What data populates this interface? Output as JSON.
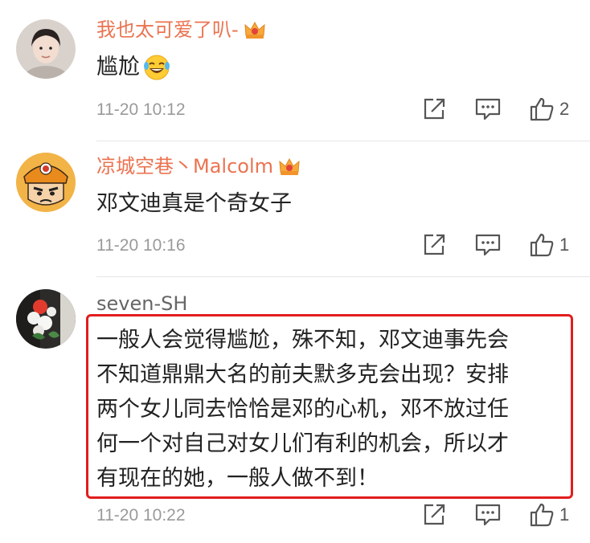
{
  "comments": [
    {
      "username": "我也太可爱了叭-",
      "vip": true,
      "text": "尴尬",
      "emoji_icon": "laughing-tears-emoji",
      "time": "11-20 10:12",
      "likes": "2"
    },
    {
      "username": "凉城空巷丶Malcolm",
      "vip": true,
      "text": "邓文迪真是个奇女子",
      "time": "11-20 10:16",
      "likes": "1"
    },
    {
      "username": "seven-SH",
      "vip": false,
      "text": "一般人会觉得尴尬，殊不知，邓文迪事先会\n不知道鼎鼎大名的前夫默多克会出现？安排\n两个女儿同去恰恰是邓的心机，邓不放过任\n何一个对自己对女儿们有利的机会，所以才\n有现在的她，一般人做不到！",
      "time": "11-20 10:22",
      "likes": "1"
    }
  ],
  "colors": {
    "username": "#eb7350",
    "username_plain": "#666666",
    "highlight": "#e21d1d",
    "time": "#9a9a9a"
  },
  "icons": [
    "share-icon",
    "comment-icon",
    "like-icon",
    "vip-crown-icon"
  ]
}
